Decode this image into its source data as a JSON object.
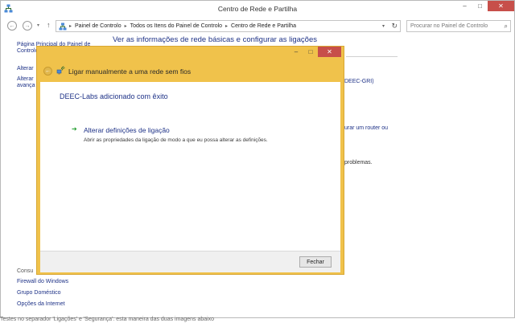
{
  "window": {
    "title": "Centro de Rede e Partilha",
    "minimize": "–",
    "maximize": "□",
    "close": "✕"
  },
  "nav": {
    "back": "←",
    "forward": "→",
    "recent": "▾",
    "up": "↑",
    "breadcrumb": [
      "Painel de Controlo",
      "Todos os Itens do Painel de Controlo",
      "Centro de Rede e Partilha"
    ],
    "breadcrumb_sep": "▸",
    "address_dropdown": "▾",
    "refresh": "↻",
    "search_placeholder": "Procurar no Painel de Controlo",
    "search_icon": "⌕"
  },
  "sidebar": {
    "home_line1": "Página Principal do Painel de",
    "home_line2": "Controlo",
    "item1": "Alterar",
    "item2_line1": "Alterar",
    "item2_line2": "avança",
    "see_also": "Consu",
    "links": [
      "Firewall do Windows",
      "Grupo Doméstico",
      "Opções da Internet"
    ]
  },
  "main": {
    "heading": "Ver as informações de rede básicas e configurar as ligações",
    "network_partial": "DEEC-GRI)",
    "router_partial": "urar um router ou",
    "problems_partial": "problemas."
  },
  "bottom_text": "Testes no separador 'Ligações' e 'Segurança': esta maneira das duas imagens abaixo",
  "dialog": {
    "title": "Ligar manualmente a uma rede sem fios",
    "minimize": "–",
    "maximize": "□",
    "close": "✕",
    "back": "←",
    "success": "DEEC-Labs adicionado com êxito",
    "link": "Alterar definições de ligação",
    "link_arrow": "➔",
    "description": "Abrir as propriedades da ligação de modo a que eu possa alterar as definições.",
    "close_button": "Fechar"
  },
  "colors": {
    "dialog_frame": "#f0c24b",
    "link_blue": "#1e3287",
    "close_red": "#c74f4a",
    "arrow_green": "#1f9c2c"
  }
}
